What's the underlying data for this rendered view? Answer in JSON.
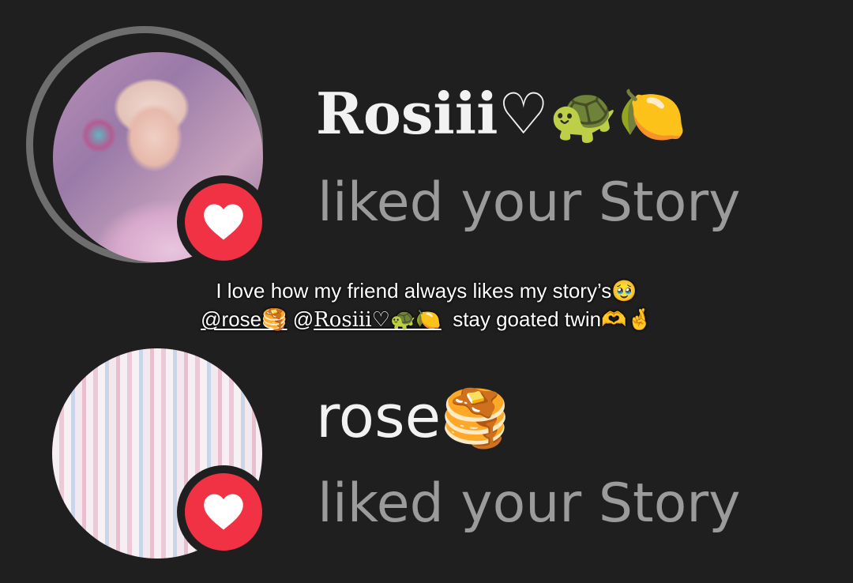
{
  "notifications": [
    {
      "username": "Rosiii♡",
      "username_emoji": "🐢🍋",
      "action_text": "liked your Story",
      "has_ring": true,
      "badge": "heart-icon"
    },
    {
      "username": "rose",
      "username_emoji": "🥞",
      "action_text": "liked your Story",
      "has_ring": false,
      "badge": "heart-icon"
    }
  ],
  "caption": {
    "line1": "I love how my friend always likes my story’s🥹",
    "mention1": "@rose🥞",
    "mention2_at": "@",
    "mention2_name": "Rosiii♡🐢🍋",
    "line2_tail": "stay goated twin🫶🤞"
  },
  "colors": {
    "background": "#1f1f1f",
    "username": "#f2f2f2",
    "action_text": "#9b9b9b",
    "heart_badge": "#f03244",
    "story_ring": "#6e6e6e"
  }
}
